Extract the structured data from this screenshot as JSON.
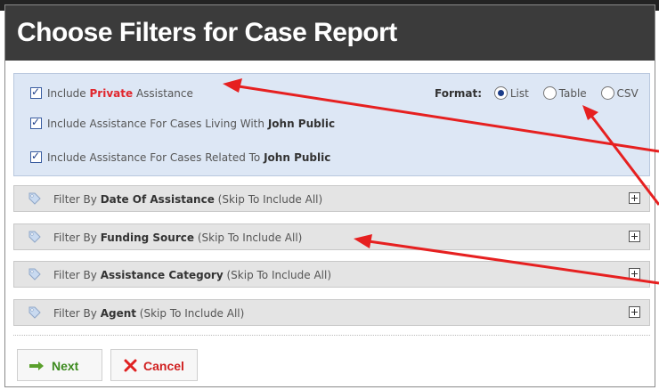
{
  "dialog": {
    "title": "Choose Filters for Case Report"
  },
  "options": [
    {
      "pre": "Include ",
      "em": "Private",
      "post": " Assistance"
    },
    {
      "pre": "Include Assistance For Cases Living With ",
      "em": "John Public",
      "post": ""
    },
    {
      "pre": "Include Assistance For Cases Related To ",
      "em": "John Public",
      "post": ""
    }
  ],
  "format": {
    "label": "Format:",
    "selected": "List",
    "choices": [
      "List",
      "Table",
      "CSV"
    ]
  },
  "filters": [
    {
      "pre": "Filter By ",
      "em": "Date Of Assistance",
      "post": " (Skip To Include All)"
    },
    {
      "pre": "Filter By ",
      "em": "Funding Source",
      "post": " (Skip To Include All)"
    },
    {
      "pre": "Filter By ",
      "em": "Assistance Category",
      "post": " (Skip To Include All)"
    },
    {
      "pre": "Filter By ",
      "em": "Agent",
      "post": " (Skip To Include All)"
    }
  ],
  "buttons": {
    "next": "Next",
    "cancel": "Cancel"
  },
  "colors": {
    "title_bg": "#3b3b3b",
    "panel_bg": "#dde7f5",
    "accent_red": "#e1262d",
    "next_green": "#3c8a1e",
    "annotation_arrow": "#e62020"
  },
  "icons": [
    "check-icon",
    "radio-icon",
    "tag-icon",
    "expand-plus-icon",
    "right-arrow-icon",
    "x-icon"
  ]
}
